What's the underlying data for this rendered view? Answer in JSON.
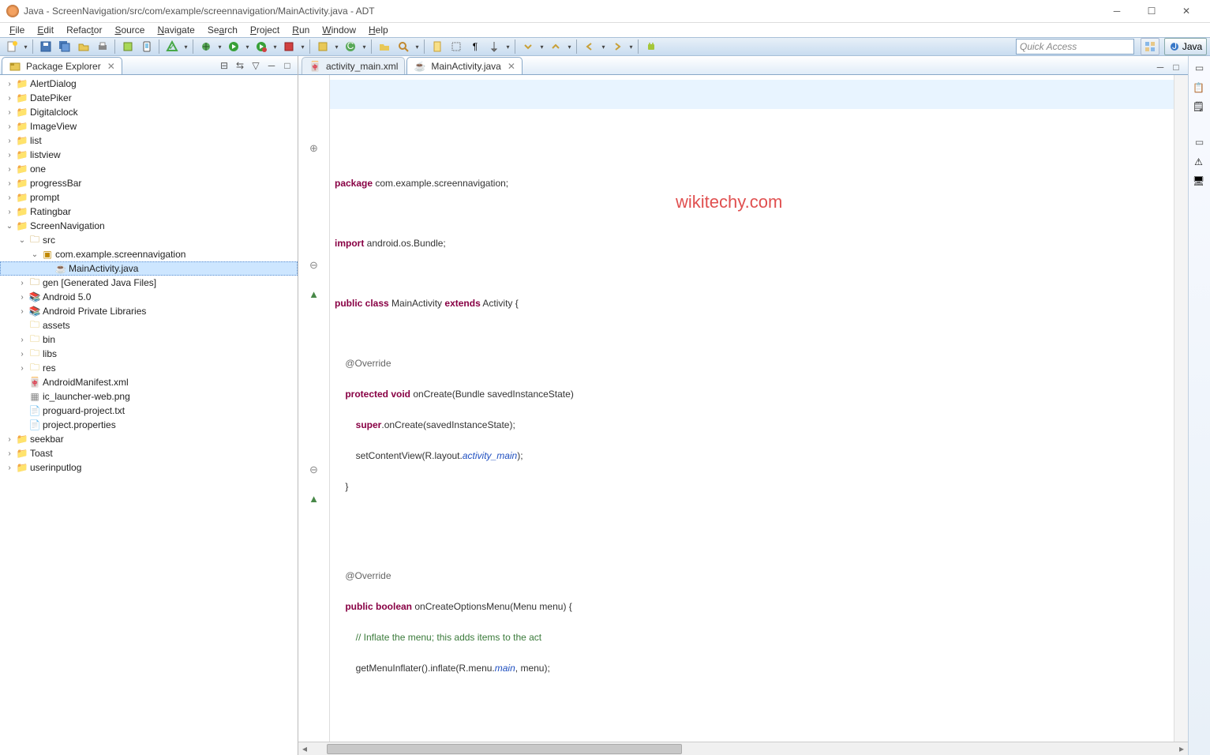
{
  "window": {
    "title": "Java - ScreenNavigation/src/com/example/screennavigation/MainActivity.java - ADT"
  },
  "menu": [
    "File",
    "Edit",
    "Refactor",
    "Source",
    "Navigate",
    "Search",
    "Project",
    "Run",
    "Window",
    "Help"
  ],
  "quick_access_placeholder": "Quick Access",
  "perspective_label": "Java",
  "package_explorer": {
    "title": "Package Explorer",
    "projects": [
      "AlertDialog",
      "DatePiker",
      "Digitalclock",
      "ImageView",
      "list",
      "listview",
      "one",
      "progressBar",
      "prompt",
      "Ratingbar",
      "ScreenNavigation",
      "seekbar",
      "Toast",
      "userinputlog"
    ],
    "src_label": "src",
    "package_name": "com.example.screennavigation",
    "java_file": "MainActivity.java",
    "gen_label": "gen",
    "gen_hint": "[Generated Java Files]",
    "android_lib": "Android 5.0",
    "android_priv": "Android Private Libraries",
    "folders": [
      "assets",
      "bin",
      "libs",
      "res"
    ],
    "files": [
      "AndroidManifest.xml",
      "ic_launcher-web.png",
      "proguard-project.txt",
      "project.properties"
    ]
  },
  "editor_tabs": [
    {
      "label": "activity_main.xml",
      "active": false
    },
    {
      "label": "MainActivity.java",
      "active": true
    }
  ],
  "watermark": "wikitechy.com",
  "code": {
    "l1_kw": "package",
    "l1_rest": " com.example.screennavigation;",
    "l3_kw": "import",
    "l3_rest": " android.os.Bundle;",
    "l5_kw1": "public class",
    "l5_mid": " MainActivity ",
    "l5_kw2": "extends",
    "l5_rest": " Activity {",
    "l7_ann": "    @Override",
    "l8_kw": "    protected void",
    "l8_rest": " onCreate(Bundle savedInstanceState) ",
    "l9_kw": "        super",
    "l9_rest": ".onCreate(savedInstanceState);",
    "l10_a": "        setContentView(R.layout.",
    "l10_it": "activity_main",
    "l10_b": ");",
    "l11": "    }",
    "l14_ann": "    @Override",
    "l15_kw": "    public boolean",
    "l15_rest": " onCreateOptionsMenu(Menu menu) {",
    "l16_cm": "        // Inflate the menu; this adds items to the act",
    "l17_a": "        getMenuInflater().inflate(R.menu.",
    "l17_it": "main",
    "l17_b": ", menu);"
  }
}
